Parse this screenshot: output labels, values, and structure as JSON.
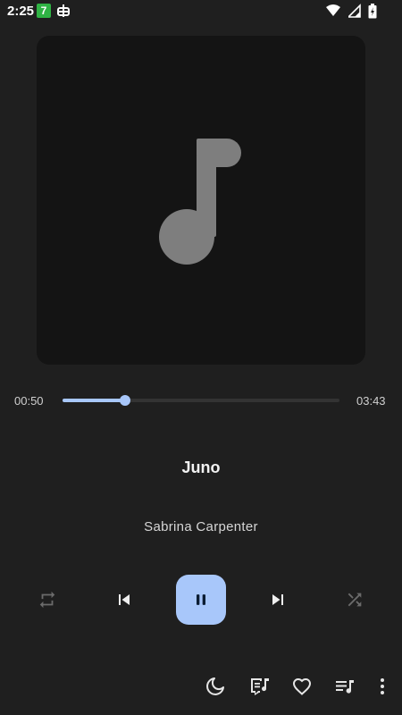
{
  "status_bar": {
    "time": "2:25",
    "notification_badge": "7",
    "icons": [
      "calendar-badge-icon",
      "bug-icon",
      "wifi-icon",
      "signal-icon",
      "battery-icon"
    ]
  },
  "player": {
    "artwork_placeholder": "music-note-icon",
    "position_text": "00:50",
    "duration_text": "03:43",
    "progress_fraction": 0.2242,
    "title": "Juno",
    "artist": "Sabrina Carpenter",
    "is_playing": true
  },
  "controls": [
    "repeat-icon",
    "skip-previous-icon",
    "pause-icon",
    "skip-next-icon",
    "shuffle-icon"
  ],
  "toolbar": [
    "sleep-timer-icon",
    "lyrics-icon",
    "favorite-icon",
    "queue-icon",
    "more-vert-icon"
  ],
  "colors": {
    "background": "#1f1f1f",
    "artwork_bg": "#141414",
    "accent": "#a8c7fa",
    "icon_dim": "#6b6b6b",
    "icon": "#e6e6e6"
  }
}
